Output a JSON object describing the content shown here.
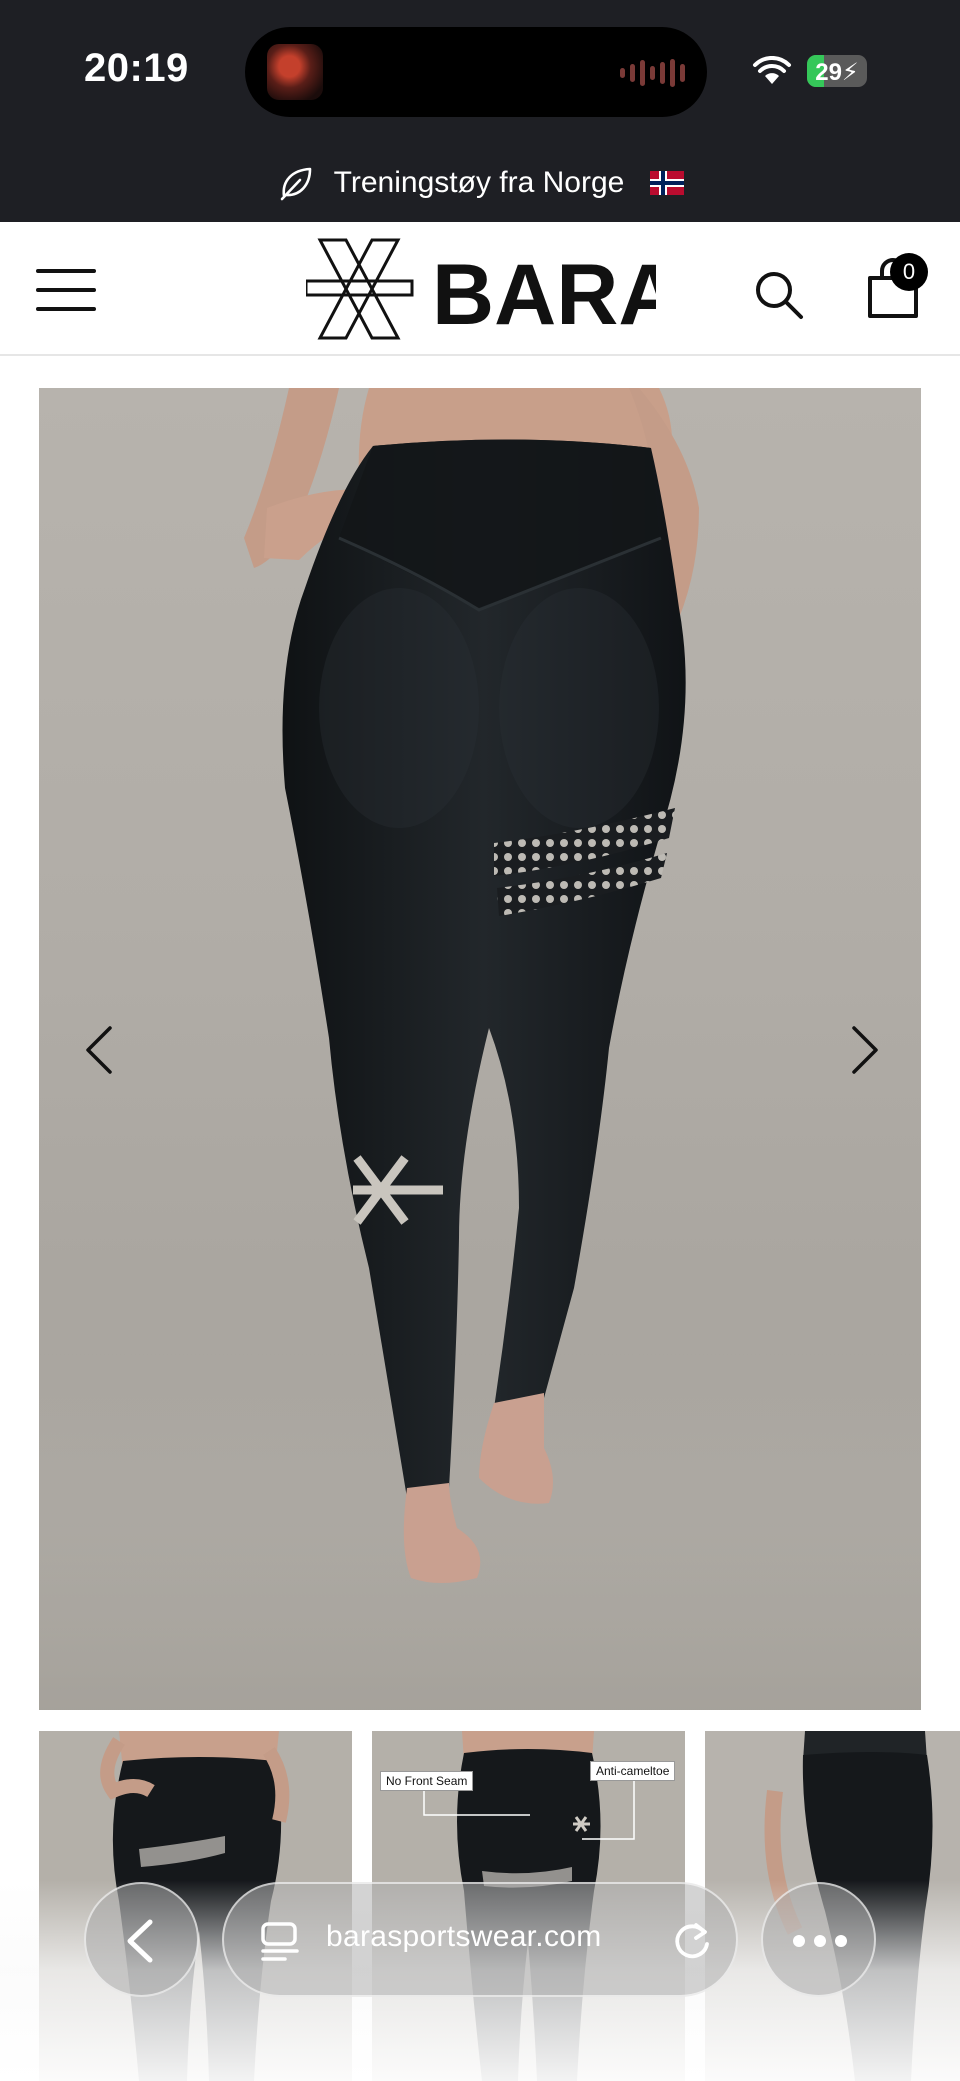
{
  "status_bar": {
    "time": "20:19",
    "battery": "29",
    "battery_level": 0.29
  },
  "announcement": {
    "text": "Treningstøy fra Norge"
  },
  "header": {
    "brand": "BARA",
    "cart_count": "0"
  },
  "product": {
    "thumbnails": [
      {
        "labels": []
      },
      {
        "labels": [
          "No Front Seam",
          "Anti-cameltoe"
        ]
      },
      {
        "labels": []
      }
    ]
  },
  "browser": {
    "url": "barasportswear.com"
  },
  "colors": {
    "top_bar": "#1e1f24",
    "legging": "#16191c",
    "backdrop": "#b1ada7",
    "battery_green": "#35c759"
  }
}
